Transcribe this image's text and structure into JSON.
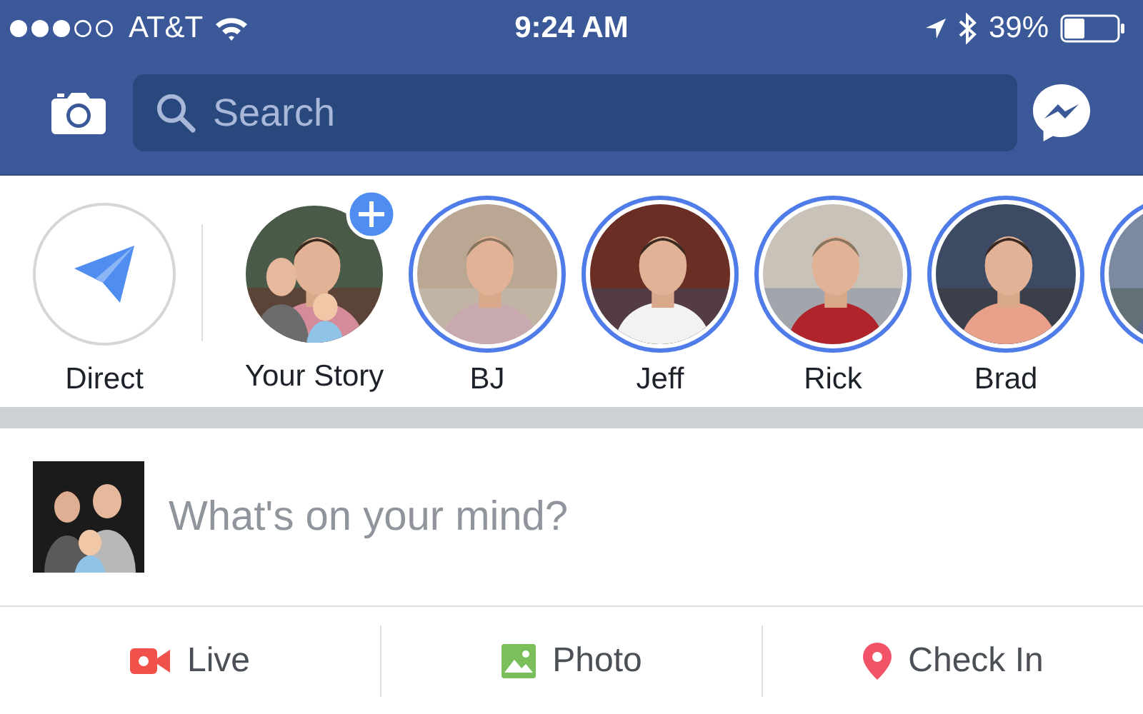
{
  "status_bar": {
    "carrier": "AT&T",
    "time": "9:24 AM",
    "battery": "39%"
  },
  "header": {
    "search": {
      "placeholder": "Search"
    }
  },
  "stories": [
    {
      "kind": "direct",
      "label": "Direct"
    },
    {
      "kind": "own",
      "label": "Your Story"
    },
    {
      "kind": "friend",
      "label": "BJ"
    },
    {
      "kind": "friend",
      "label": "Jeff"
    },
    {
      "kind": "friend",
      "label": "Rick"
    },
    {
      "kind": "friend",
      "label": "Brad"
    },
    {
      "kind": "friend"
    }
  ],
  "composer": {
    "placeholder": "What's on your mind?"
  },
  "actions": [
    {
      "kind": "live",
      "label": "Live"
    },
    {
      "label": "Photo"
    },
    {
      "kind": "checkin",
      "label": "Check In"
    }
  ]
}
